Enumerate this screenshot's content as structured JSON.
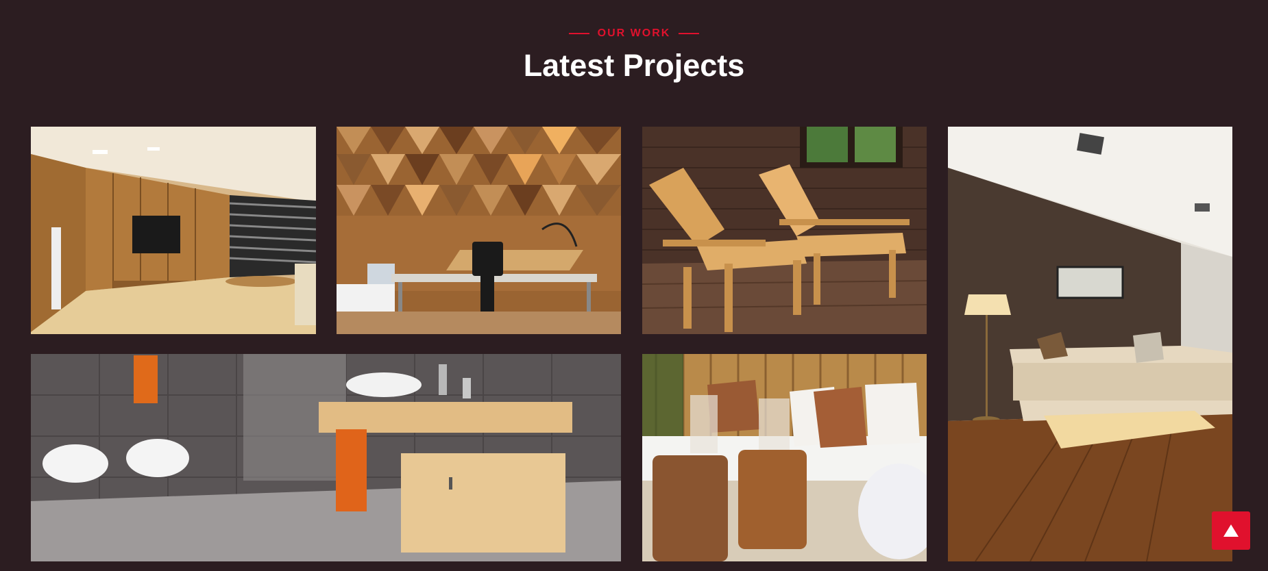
{
  "section": {
    "eyebrow": "OUR WORK",
    "title": "Latest Projects"
  },
  "projects": [
    {
      "name": "living-room-wood-paneling"
    },
    {
      "name": "office-triangle-wall"
    },
    {
      "name": "wooden-deck-chairs"
    },
    {
      "name": "brown-wall-living-room"
    },
    {
      "name": "modern-bathroom"
    },
    {
      "name": "bamboo-patio-lounge"
    }
  ],
  "colors": {
    "background": "#2c1d21",
    "accent": "#e0112d",
    "title": "#ffffff"
  },
  "scroll_top": {
    "icon": "arrow-up-icon"
  }
}
